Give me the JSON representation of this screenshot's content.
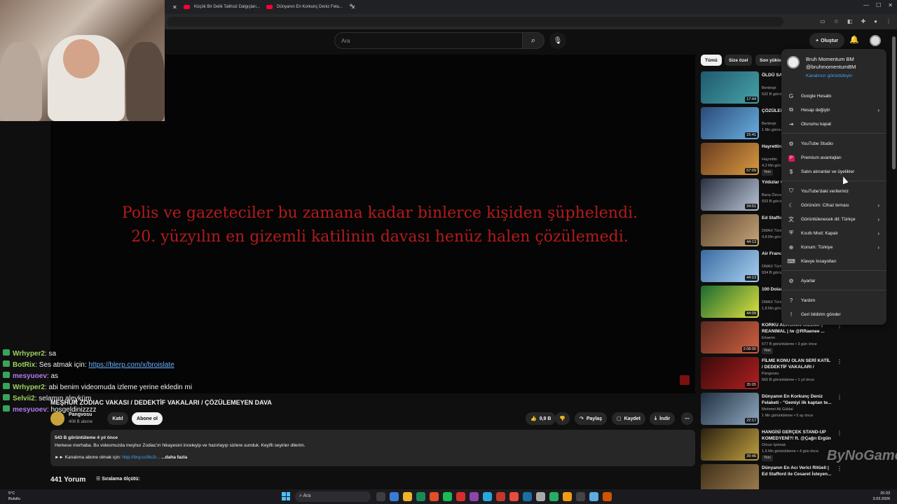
{
  "browser": {
    "tabs": [
      {
        "title": "Küçük Bir Delik Talihsiz Dalgıçları..."
      },
      {
        "title": "Dünyanın En Korkunç Deniz Fela..."
      }
    ]
  },
  "youtube": {
    "search_placeholder": "Ara",
    "create_label": "Oluştur"
  },
  "video": {
    "caption_line1": "Polis ve gazeteciler bu zamana kadar binlerce kişiden şüphelendi.",
    "caption_line2": "20. yüzyılın en gizemli katilinin davası henüz halen çözülemedi.",
    "title": "MEŞHUR ZODIAC VAKASI / DEDEKTİF VAKALARI / ÇÖZÜLEMEYEN DAVA",
    "channel": "Pangvosu",
    "subscribers": "408 B abone",
    "join_label": "Katıl",
    "subscribe_label": "Abone ol",
    "likes": "9,9 B",
    "share_label": "Paylaş",
    "save_label": "Kaydet",
    "download_label": "İndir",
    "views_line": "543 B görüntüleme  4 yıl önce",
    "description": "Herkese merhaba. Bu videomuzda meşhur Zodiac'ın hikayesini inceleyip ve hazırlayıp sizlere sunduk. Keyifli seyirler dilerim.",
    "subscribe_line": "►► Kanalıma abone olmak için:",
    "subscribe_link": "http://tiny.cc/8o2r...",
    "more_label": "...daha fazla",
    "comments": "441 Yorum",
    "sort_label": "Sıralama ölçütü:"
  },
  "chat": [
    {
      "user": "Wrhyper2",
      "msg": ": sa",
      "color": "green"
    },
    {
      "user": "BotRix",
      "msg": ": Ses atmak için: ",
      "link": "https://blerp.com/x/broislate",
      "color": "green"
    },
    {
      "user": "mesyuoev",
      "msg": ": as",
      "color": "purple"
    },
    {
      "user": "Wrhyper2",
      "msg": ": abi benim videomuda izleme yerine ekledin mi",
      "color": "green"
    },
    {
      "user": "Selvii2",
      "msg": ": selamın aleyküm",
      "color": "green"
    },
    {
      "user": "mesyuoev",
      "msg": ": hoşgeldinizzzz",
      "color": "purple"
    }
  ],
  "chips": [
    "Tümü",
    "Size özel",
    "Son yüklenenler"
  ],
  "related": [
    {
      "title": "ÖLDÜ SANDI ZİRVESİNDE...",
      "meta": "Bentropi\n532 B görüntüleme",
      "dur": "17:44",
      "c1": "#1f5a6e",
      "c2": "#47a2a8"
    },
    {
      "title": "ÇÖZÜLEMEYEN Cooper...",
      "meta": "Bentropi\n1 Mn görüntüleme",
      "dur": "15:41",
      "c1": "#2a4a7a",
      "c2": "#6ab0e0"
    },
    {
      "title": "Hayrettin 2.Sezon...",
      "meta": "Hayrettin\n4,2 Mn görüntüleme",
      "dur": "57:09",
      "c1": "#6a3b20",
      "c2": "#d89b40",
      "new": "Yeni"
    },
    {
      "title": "Yıldızlar Gidemey...",
      "meta": "Barış Özcan\n593 B görüntüleme",
      "dur": "34:51",
      "c1": "#2a3040",
      "c2": "#b8c4d4"
    },
    {
      "title": "Ed Stafford Part I",
      "meta": "DMAX Türkiye\n4,8 Mn görüntüleme",
      "dur": "44:13",
      "c1": "#5a4630",
      "c2": "#c9a57a"
    },
    {
      "title": "Air France Oldu? | E...",
      "meta": "DMAX Türkiye\n934 B görüntüleme",
      "dur": "44:13",
      "c1": "#3a6aa0",
      "c2": "#a8d0f0"
    },
    {
      "title": "100 Dolar Gizli Mily...",
      "meta": "DMAX Türkiye\n1,8 Mn görüntüleme",
      "dur": "44:09",
      "c1": "#1a6a30",
      "c2": "#e0e040"
    },
    {
      "title": "KORKU ADASININ GİZEMİ! | REANIMAL | /w @RRaenee ...",
      "meta": "Elraenn\n577 B görüntüleme • 3 gün önce",
      "dur": "2:08:00",
      "c1": "#5a2a20",
      "c2": "#d06040",
      "new": "Yeni"
    },
    {
      "title": "FİLME KONU OLAN SERİ KATİL / DEDEKTİF VAKALARI /",
      "meta": "Pangvosu\n565 B görüntüleme • 1 yıl önce",
      "dur": "35:05",
      "c1": "#3a0a0a",
      "c2": "#b02020"
    },
    {
      "title": "Dünyanın En Korkunç Deniz Felaketi - \"Gemiyi ilk kaptan te...",
      "meta": "Mehmet Ali Güldal\n1 Mn görüntüleme • 5 ay önce",
      "dur": "22:17",
      "c1": "#203040",
      "c2": "#90a8c0"
    },
    {
      "title": "HANGİSİ GERÇEK STAND-UP KOMEDYENİ?! ft. @Çağrı Ergün",
      "meta": "Orkun Işıtmak\n1,6 Mn görüntüleme • 4 gün önce",
      "dur": "39:46",
      "c1": "#2a2010",
      "c2": "#c0a040",
      "new": "Yeni"
    },
    {
      "title": "Dünyanın En Acı Verici Ritüeli | Ed Stafford ile Cesaret İsteyen...",
      "meta": "",
      "dur": "",
      "c1": "#40301a",
      "c2": "#a08050"
    }
  ],
  "account_menu": {
    "name": "Bruh Momentum BM",
    "handle": "@bruhmomentumBM",
    "channel_link": "Kanalınızı görüntüleyin",
    "items": [
      {
        "label": "Google Hesabı",
        "icon": "G",
        "chev": false,
        "sep_before": false
      },
      {
        "label": "Hesap değiştir",
        "icon": "⧉",
        "chev": true,
        "sep_before": false
      },
      {
        "label": "Oturumu kapat",
        "icon": "⇥",
        "chev": false,
        "sep_before": false
      },
      {
        "label": "YouTube Studio",
        "icon": "⚙",
        "chev": false,
        "sep_before": true
      },
      {
        "label": "Premium avantajları",
        "icon": "P",
        "chev": false,
        "sep_before": false
      },
      {
        "label": "Satın alınanlar ve üyelikler",
        "icon": "$",
        "chev": false,
        "sep_before": false
      },
      {
        "label": "YouTube'daki verileriniz",
        "icon": "⛉",
        "chev": false,
        "sep_before": true
      },
      {
        "label": "Görünüm: Cihaz teması",
        "icon": "☾",
        "chev": true,
        "sep_before": false
      },
      {
        "label": "Görüntülenecek dil: Türkçe",
        "icon": "文",
        "chev": true,
        "sep_before": false
      },
      {
        "label": "Kısıtlı Mod: Kapalı",
        "icon": "⛨",
        "chev": true,
        "sep_before": false
      },
      {
        "label": "Konum: Türkiye",
        "icon": "⊕",
        "chev": true,
        "sep_before": false
      },
      {
        "label": "Klavye kısayolları",
        "icon": "⌨",
        "chev": false,
        "sep_before": false
      },
      {
        "label": "Ayarlar",
        "icon": "⚙",
        "chev": false,
        "sep_before": true
      },
      {
        "label": "Yardım",
        "icon": "?",
        "chev": false,
        "sep_before": true
      },
      {
        "label": "Geri bildirim gönder",
        "icon": "!",
        "chev": false,
        "sep_before": false
      }
    ]
  },
  "watermark": "ByNoGame",
  "taskbar": {
    "weather_temp": "5°C",
    "weather_desc": "Bulutlu",
    "search": "Ara",
    "time": "20:33",
    "date": "3.03.2026"
  }
}
